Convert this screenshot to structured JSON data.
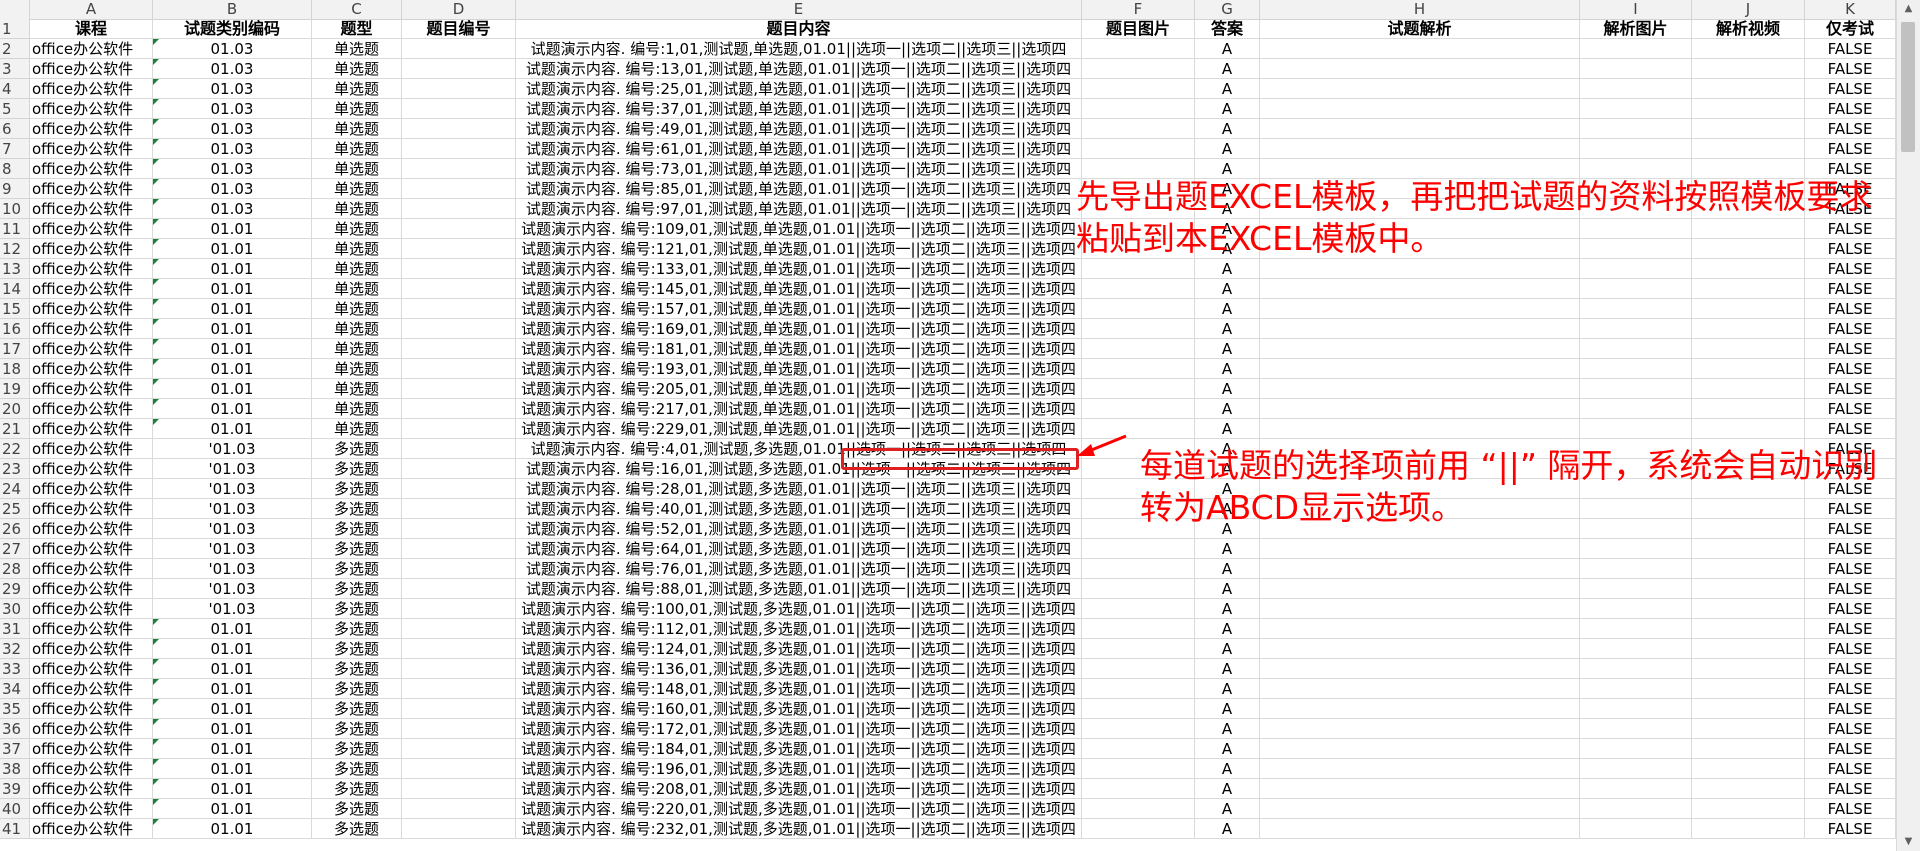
{
  "columns": [
    "A",
    "B",
    "C",
    "D",
    "E",
    "F",
    "G",
    "H",
    "I",
    "J",
    "K"
  ],
  "header_row": {
    "row_number": "1",
    "cells": [
      "课程",
      "试题类别编码",
      "题型",
      "题目编号",
      "题目内容",
      "题目图片",
      "答案",
      "试题解析",
      "解析图片",
      "解析视频",
      "仅考试"
    ]
  },
  "rows": [
    {
      "n": "2",
      "course": "office办公软件",
      "code": "01.03",
      "type": "单选题",
      "content": "试题演示内容. 编号:1,01,测试题,单选题,01.01||选项一||选项二||选项三||选项四",
      "answer": "A",
      "flag": "FALSE",
      "mark": true
    },
    {
      "n": "3",
      "course": "office办公软件",
      "code": "01.03",
      "type": "单选题",
      "content": "试题演示内容. 编号:13,01,测试题,单选题,01.01||选项一||选项二||选项三||选项四",
      "answer": "A",
      "flag": "FALSE",
      "mark": true
    },
    {
      "n": "4",
      "course": "office办公软件",
      "code": "01.03",
      "type": "单选题",
      "content": "试题演示内容. 编号:25,01,测试题,单选题,01.01||选项一||选项二||选项三||选项四",
      "answer": "A",
      "flag": "FALSE",
      "mark": true
    },
    {
      "n": "5",
      "course": "office办公软件",
      "code": "01.03",
      "type": "单选题",
      "content": "试题演示内容. 编号:37,01,测试题,单选题,01.01||选项一||选项二||选项三||选项四",
      "answer": "A",
      "flag": "FALSE",
      "mark": true
    },
    {
      "n": "6",
      "course": "office办公软件",
      "code": "01.03",
      "type": "单选题",
      "content": "试题演示内容. 编号:49,01,测试题,单选题,01.01||选项一||选项二||选项三||选项四",
      "answer": "A",
      "flag": "FALSE",
      "mark": true
    },
    {
      "n": "7",
      "course": "office办公软件",
      "code": "01.03",
      "type": "单选题",
      "content": "试题演示内容. 编号:61,01,测试题,单选题,01.01||选项一||选项二||选项三||选项四",
      "answer": "A",
      "flag": "FALSE",
      "mark": true
    },
    {
      "n": "8",
      "course": "office办公软件",
      "code": "01.03",
      "type": "单选题",
      "content": "试题演示内容. 编号:73,01,测试题,单选题,01.01||选项一||选项二||选项三||选项四",
      "answer": "A",
      "flag": "FALSE",
      "mark": true
    },
    {
      "n": "9",
      "course": "office办公软件",
      "code": "01.03",
      "type": "单选题",
      "content": "试题演示内容. 编号:85,01,测试题,单选题,01.01||选项一||选项二||选项三||选项四",
      "answer": "A",
      "flag": "FALSE",
      "mark": true
    },
    {
      "n": "10",
      "course": "office办公软件",
      "code": "01.03",
      "type": "单选题",
      "content": "试题演示内容. 编号:97,01,测试题,单选题,01.01||选项一||选项二||选项三||选项四",
      "answer": "A",
      "flag": "FALSE",
      "mark": true
    },
    {
      "n": "11",
      "course": "office办公软件",
      "code": "01.01",
      "type": "单选题",
      "content": "试题演示内容. 编号:109,01,测试题,单选题,01.01||选项一||选项二||选项三||选项四",
      "answer": "A",
      "flag": "FALSE",
      "mark": true
    },
    {
      "n": "12",
      "course": "office办公软件",
      "code": "01.01",
      "type": "单选题",
      "content": "试题演示内容. 编号:121,01,测试题,单选题,01.01||选项一||选项二||选项三||选项四",
      "answer": "A",
      "flag": "FALSE",
      "mark": true
    },
    {
      "n": "13",
      "course": "office办公软件",
      "code": "01.01",
      "type": "单选题",
      "content": "试题演示内容. 编号:133,01,测试题,单选题,01.01||选项一||选项二||选项三||选项四",
      "answer": "A",
      "flag": "FALSE",
      "mark": true
    },
    {
      "n": "14",
      "course": "office办公软件",
      "code": "01.01",
      "type": "单选题",
      "content": "试题演示内容. 编号:145,01,测试题,单选题,01.01||选项一||选项二||选项三||选项四",
      "answer": "A",
      "flag": "FALSE",
      "mark": true
    },
    {
      "n": "15",
      "course": "office办公软件",
      "code": "01.01",
      "type": "单选题",
      "content": "试题演示内容. 编号:157,01,测试题,单选题,01.01||选项一||选项二||选项三||选项四",
      "answer": "A",
      "flag": "FALSE",
      "mark": true
    },
    {
      "n": "16",
      "course": "office办公软件",
      "code": "01.01",
      "type": "单选题",
      "content": "试题演示内容. 编号:169,01,测试题,单选题,01.01||选项一||选项二||选项三||选项四",
      "answer": "A",
      "flag": "FALSE",
      "mark": true
    },
    {
      "n": "17",
      "course": "office办公软件",
      "code": "01.01",
      "type": "单选题",
      "content": "试题演示内容. 编号:181,01,测试题,单选题,01.01||选项一||选项二||选项三||选项四",
      "answer": "A",
      "flag": "FALSE",
      "mark": true
    },
    {
      "n": "18",
      "course": "office办公软件",
      "code": "01.01",
      "type": "单选题",
      "content": "试题演示内容. 编号:193,01,测试题,单选题,01.01||选项一||选项二||选项三||选项四",
      "answer": "A",
      "flag": "FALSE",
      "mark": true
    },
    {
      "n": "19",
      "course": "office办公软件",
      "code": "01.01",
      "type": "单选题",
      "content": "试题演示内容. 编号:205,01,测试题,单选题,01.01||选项一||选项二||选项三||选项四",
      "answer": "A",
      "flag": "FALSE",
      "mark": true
    },
    {
      "n": "20",
      "course": "office办公软件",
      "code": "01.01",
      "type": "单选题",
      "content": "试题演示内容. 编号:217,01,测试题,单选题,01.01||选项一||选项二||选项三||选项四",
      "answer": "A",
      "flag": "FALSE",
      "mark": true
    },
    {
      "n": "21",
      "course": "office办公软件",
      "code": "01.01",
      "type": "单选题",
      "content": "试题演示内容. 编号:229,01,测试题,单选题,01.01||选项一||选项二||选项三||选项四",
      "answer": "A",
      "flag": "FALSE",
      "mark": true
    },
    {
      "n": "22",
      "course": "office办公软件",
      "code": "'01.03",
      "type": "多选题",
      "content": "试题演示内容. 编号:4,01,测试题,多选题,01.01||选项一||选项二||选项三||选项四",
      "answer": "A",
      "flag": "FALSE",
      "mark": false
    },
    {
      "n": "23",
      "course": "office办公软件",
      "code": "'01.03",
      "type": "多选题",
      "content": "试题演示内容. 编号:16,01,测试题,多选题,01.01||选项一||选项二||选项三||选项四",
      "answer": "A",
      "flag": "FALSE",
      "mark": false
    },
    {
      "n": "24",
      "course": "office办公软件",
      "code": "'01.03",
      "type": "多选题",
      "content": "试题演示内容. 编号:28,01,测试题,多选题,01.01||选项一||选项二||选项三||选项四",
      "answer": "A",
      "flag": "FALSE",
      "mark": false
    },
    {
      "n": "25",
      "course": "office办公软件",
      "code": "'01.03",
      "type": "多选题",
      "content": "试题演示内容. 编号:40,01,测试题,多选题,01.01||选项一||选项二||选项三||选项四",
      "answer": "A",
      "flag": "FALSE",
      "mark": false
    },
    {
      "n": "26",
      "course": "office办公软件",
      "code": "'01.03",
      "type": "多选题",
      "content": "试题演示内容. 编号:52,01,测试题,多选题,01.01||选项一||选项二||选项三||选项四",
      "answer": "A",
      "flag": "FALSE",
      "mark": false
    },
    {
      "n": "27",
      "course": "office办公软件",
      "code": "'01.03",
      "type": "多选题",
      "content": "试题演示内容. 编号:64,01,测试题,多选题,01.01||选项一||选项二||选项三||选项四",
      "answer": "A",
      "flag": "FALSE",
      "mark": false
    },
    {
      "n": "28",
      "course": "office办公软件",
      "code": "'01.03",
      "type": "多选题",
      "content": "试题演示内容. 编号:76,01,测试题,多选题,01.01||选项一||选项二||选项三||选项四",
      "answer": "A",
      "flag": "FALSE",
      "mark": false
    },
    {
      "n": "29",
      "course": "office办公软件",
      "code": "'01.03",
      "type": "多选题",
      "content": "试题演示内容. 编号:88,01,测试题,多选题,01.01||选项一||选项二||选项三||选项四",
      "answer": "A",
      "flag": "FALSE",
      "mark": false
    },
    {
      "n": "30",
      "course": "office办公软件",
      "code": "'01.03",
      "type": "多选题",
      "content": "试题演示内容. 编号:100,01,测试题,多选题,01.01||选项一||选项二||选项三||选项四",
      "answer": "A",
      "flag": "FALSE",
      "mark": false
    },
    {
      "n": "31",
      "course": "office办公软件",
      "code": "01.01",
      "type": "多选题",
      "content": "试题演示内容. 编号:112,01,测试题,多选题,01.01||选项一||选项二||选项三||选项四",
      "answer": "A",
      "flag": "FALSE",
      "mark": true
    },
    {
      "n": "32",
      "course": "office办公软件",
      "code": "01.01",
      "type": "多选题",
      "content": "试题演示内容. 编号:124,01,测试题,多选题,01.01||选项一||选项二||选项三||选项四",
      "answer": "A",
      "flag": "FALSE",
      "mark": true
    },
    {
      "n": "33",
      "course": "office办公软件",
      "code": "01.01",
      "type": "多选题",
      "content": "试题演示内容. 编号:136,01,测试题,多选题,01.01||选项一||选项二||选项三||选项四",
      "answer": "A",
      "flag": "FALSE",
      "mark": true
    },
    {
      "n": "34",
      "course": "office办公软件",
      "code": "01.01",
      "type": "多选题",
      "content": "试题演示内容. 编号:148,01,测试题,多选题,01.01||选项一||选项二||选项三||选项四",
      "answer": "A",
      "flag": "FALSE",
      "mark": true
    },
    {
      "n": "35",
      "course": "office办公软件",
      "code": "01.01",
      "type": "多选题",
      "content": "试题演示内容. 编号:160,01,测试题,多选题,01.01||选项一||选项二||选项三||选项四",
      "answer": "A",
      "flag": "FALSE",
      "mark": true
    },
    {
      "n": "36",
      "course": "office办公软件",
      "code": "01.01",
      "type": "多选题",
      "content": "试题演示内容. 编号:172,01,测试题,多选题,01.01||选项一||选项二||选项三||选项四",
      "answer": "A",
      "flag": "FALSE",
      "mark": true
    },
    {
      "n": "37",
      "course": "office办公软件",
      "code": "01.01",
      "type": "多选题",
      "content": "试题演示内容. 编号:184,01,测试题,多选题,01.01||选项一||选项二||选项三||选项四",
      "answer": "A",
      "flag": "FALSE",
      "mark": true
    },
    {
      "n": "38",
      "course": "office办公软件",
      "code": "01.01",
      "type": "多选题",
      "content": "试题演示内容. 编号:196,01,测试题,多选题,01.01||选项一||选项二||选项三||选项四",
      "answer": "A",
      "flag": "FALSE",
      "mark": true
    },
    {
      "n": "39",
      "course": "office办公软件",
      "code": "01.01",
      "type": "多选题",
      "content": "试题演示内容. 编号:208,01,测试题,多选题,01.01||选项一||选项二||选项三||选项四",
      "answer": "A",
      "flag": "FALSE",
      "mark": true
    },
    {
      "n": "40",
      "course": "office办公软件",
      "code": "01.01",
      "type": "多选题",
      "content": "试题演示内容. 编号:220,01,测试题,多选题,01.01||选项一||选项二||选项三||选项四",
      "answer": "A",
      "flag": "FALSE",
      "mark": true
    },
    {
      "n": "41",
      "course": "office办公软件",
      "code": "01.01",
      "type": "多选题",
      "content": "试题演示内容. 编号:232,01,测试题,多选题,01.01||选项一||选项二||选项三||选项四",
      "answer": "A",
      "flag": "FALSE",
      "mark": true
    }
  ],
  "annotations": {
    "note1_line1": "先导出题EXCEL模板，再把把试题的资料按照模板要求",
    "note1_line2": "粘贴到本EXCEL模板中。",
    "note2_line1": "每道试题的选择项前用 “||” 隔开，系统会自动识别",
    "note2_line2": "转为ABCD显示选项。",
    "color": "#ff0000"
  },
  "colors": {
    "header_bg": "#f2f2f2",
    "gridline": "#dadada",
    "number_stored_as_text_marker": "#1e7f3a"
  },
  "icons": {
    "scroll_up": "triangle-up-icon",
    "scroll_down": "triangle-down-icon"
  }
}
